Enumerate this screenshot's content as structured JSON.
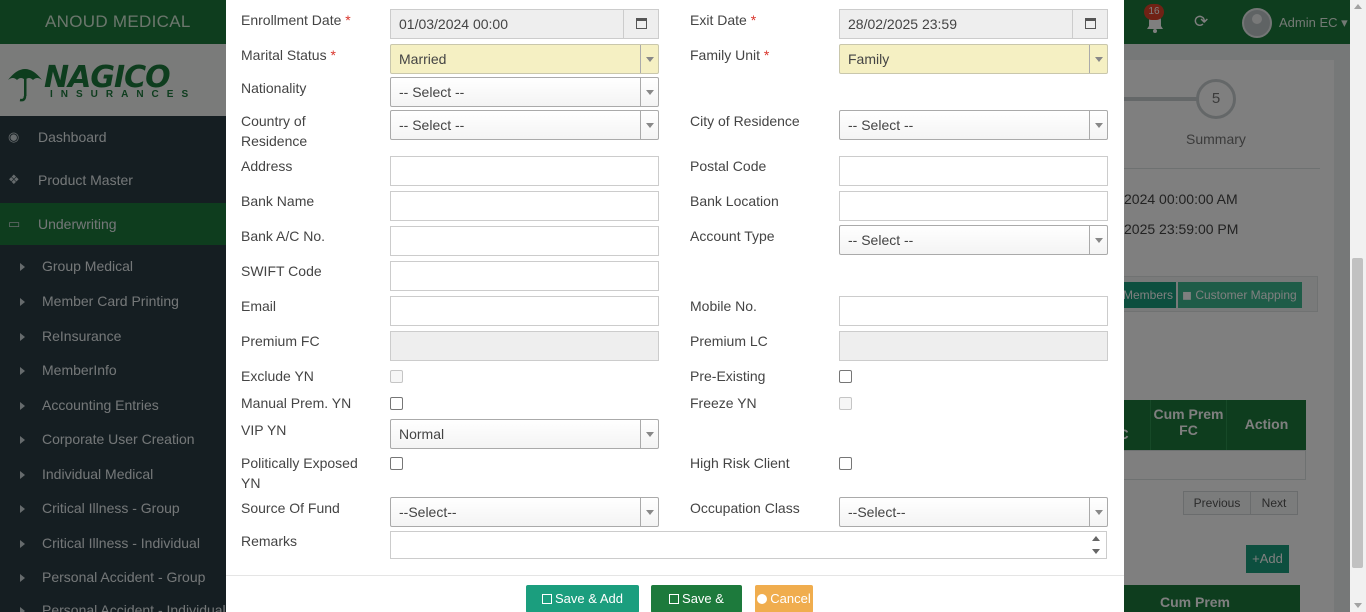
{
  "app": {
    "name": "ANOUD MEDICAL",
    "notification_count": "16",
    "user_name": "Admin EC",
    "logo_main": "NAGICO",
    "logo_sub": "INSURANCES"
  },
  "sidebar": {
    "items": [
      {
        "label": "Dashboard",
        "icon": "dashboard-icon"
      },
      {
        "label": "Product Master",
        "icon": "cubes-icon"
      },
      {
        "label": "Underwriting",
        "icon": "monitor-icon"
      }
    ],
    "sub_items": [
      "Group Medical",
      "Member Card Printing",
      "ReInsurance",
      "MemberInfo",
      "Accounting Entries",
      "Corporate User Creation",
      "Individual Medical",
      "Critical Illness - Group",
      "Critical Illness - Individual",
      "Personal Accident - Group",
      "Personal Accident - Individual"
    ]
  },
  "background": {
    "step_number": "5",
    "step_label": "Summary",
    "date1": "2024 00:00:00 AM",
    "date2": "2025 23:59:00 PM",
    "tab_members": "Members",
    "tab_customer_mapping": "Customer Mapping",
    "th_cum_prem": "Cum Prem FC",
    "th_action": "Action",
    "th_partial": "C",
    "prev": "Previous",
    "next": "Next",
    "add": "Add",
    "th2": "Cum Prem"
  },
  "form": {
    "enrollment_date": {
      "label": "Enrollment Date",
      "value": "01/03/2024 00:00"
    },
    "exit_date": {
      "label": "Exit Date",
      "value": "28/02/2025 23:59"
    },
    "marital_status": {
      "label": "Marital Status",
      "value": "Married"
    },
    "family_unit": {
      "label": "Family Unit",
      "value": "Family"
    },
    "nationality": {
      "label": "Nationality",
      "value": "-- Select --"
    },
    "country_of_residence": {
      "label": "Country of Residence",
      "value": "-- Select --"
    },
    "city_of_residence": {
      "label": "City of Residence",
      "value": "-- Select --"
    },
    "address": {
      "label": "Address",
      "value": ""
    },
    "postal_code": {
      "label": "Postal Code",
      "value": ""
    },
    "bank_name": {
      "label": "Bank Name",
      "value": ""
    },
    "bank_location": {
      "label": "Bank Location",
      "value": ""
    },
    "bank_ac_no": {
      "label": "Bank A/C No.",
      "value": ""
    },
    "account_type": {
      "label": "Account Type",
      "value": "-- Select --"
    },
    "swift_code": {
      "label": "SWIFT Code",
      "value": ""
    },
    "email": {
      "label": "Email",
      "value": ""
    },
    "mobile_no": {
      "label": "Mobile No.",
      "value": ""
    },
    "premium_fc": {
      "label": "Premium FC",
      "value": ""
    },
    "premium_lc": {
      "label": "Premium LC",
      "value": ""
    },
    "exclude_yn": {
      "label": "Exclude YN"
    },
    "pre_existing": {
      "label": "Pre-Existing"
    },
    "manual_prem_yn": {
      "label": "Manual Prem. YN"
    },
    "freeze_yn": {
      "label": "Freeze YN"
    },
    "vip_yn": {
      "label": "VIP YN",
      "value": "Normal"
    },
    "politically_exposed_yn": {
      "label": "Politically Exposed YN"
    },
    "high_risk_client": {
      "label": "High Risk Client"
    },
    "source_of_fund": {
      "label": "Source Of Fund",
      "value": "--Select--"
    },
    "occupation_class": {
      "label": "Occupation Class",
      "value": "--Select--"
    },
    "remarks": {
      "label": "Remarks",
      "value": ""
    },
    "required_mark": "*"
  },
  "buttons": {
    "save_add_more": "Save & Add More",
    "save_close": "Save & Close",
    "cancel": "Cancel"
  },
  "colors": {
    "brand_green": "#1d7a3c",
    "teal": "#1b9e7e",
    "cancel_orange": "#f0ad4e",
    "required_fill": "#f5f0c3"
  }
}
